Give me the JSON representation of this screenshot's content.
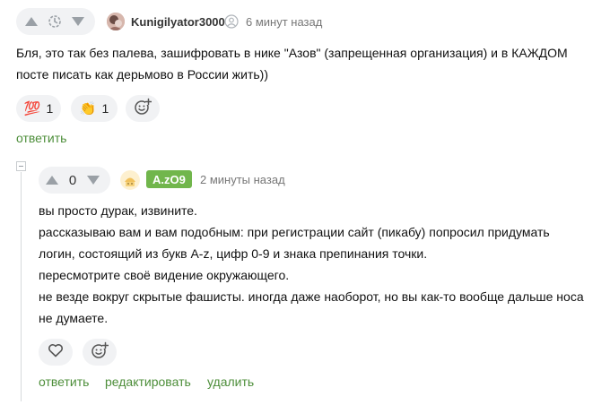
{
  "comment1": {
    "username": "Kunigilyator3000",
    "time": "6 минут назад",
    "lines": [
      "Бля, это так без палева, зашифровать в нике \"Азов\" (запрещенная организация) и в КАЖДОМ",
      "посте писать как дерьмово в России жить))"
    ],
    "reactions": [
      {
        "emoji": "💯",
        "count": "1",
        "icon": "hundred-icon"
      },
      {
        "emoji": "👏",
        "count": "1",
        "icon": "clapping-hands-icon"
      }
    ],
    "reply_label": "ответить"
  },
  "comment2": {
    "rating": "0",
    "username": "A.zO9",
    "time": "2 минуты назад",
    "lines": [
      "вы просто дурак, извините.",
      "рассказываю вам и вам подобным: при регистрации сайт (пикабу) попросил придумать",
      "логин, состоящий из букв A-z, цифр 0-9 и знака препинания точки.",
      "пересмотрите своё видение окружающего.",
      "не везде вокруг скрытые фашисты. иногда даже наоборот, но вы как-то вообще дальше носа",
      "не думаете."
    ],
    "reply_label": "ответить",
    "edit_label": "редактировать",
    "delete_label": "удалить"
  },
  "colors": {
    "green": "#4d8e3a",
    "badge": "#71b64c",
    "pill_bg": "#f1f2f4",
    "triangle": "#9aa0a6"
  }
}
